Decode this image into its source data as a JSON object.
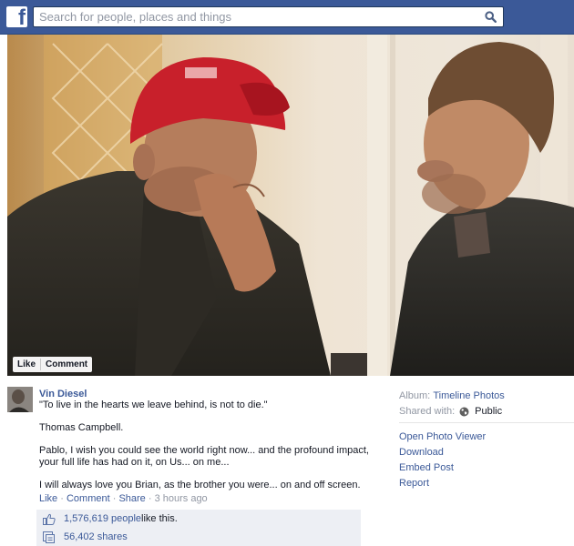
{
  "search": {
    "placeholder": "Search for people, places and things"
  },
  "photo_actions": {
    "like": "Like",
    "comment": "Comment"
  },
  "post": {
    "author": "Vin Diesel",
    "lines": [
      "\"To live in the hearts we leave behind, is not to die.\"",
      "Thomas Campbell.",
      "Pablo, I wish you could see the world right now... and the profound impact,",
      "your full life has had on it, on Us... on me...",
      "I will always love you Brian, as the brother you were... on and off screen."
    ],
    "actions": {
      "like": "Like",
      "comment": "Comment",
      "share": "Share",
      "time": "3 hours ago",
      "dot": " · "
    },
    "likes": {
      "count": "1,576,619 people",
      "suffix": " like this."
    },
    "shares": "56,402 shares"
  },
  "sidebar": {
    "album_label": "Album:",
    "album_name": "Timeline Photos",
    "shared_label": "Shared with:",
    "shared_value": "Public",
    "menu": [
      "Open Photo Viewer",
      "Download",
      "Embed Post",
      "Report"
    ]
  },
  "icons": [
    "facebook-logo-icon",
    "search-icon",
    "globe-icon",
    "thumbs-up-icon",
    "share-icon"
  ],
  "colors": {
    "brand": "#3b5998",
    "link": "#3b5998",
    "muted": "#9197a3",
    "stat_bg": "#edeff4"
  }
}
